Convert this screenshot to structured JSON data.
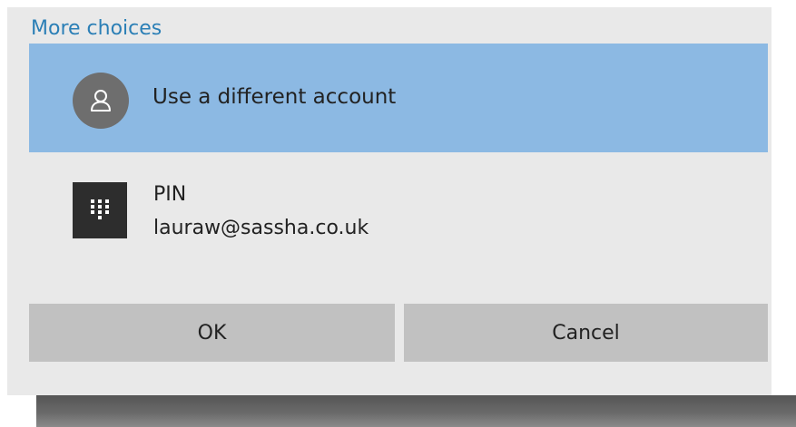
{
  "dialog": {
    "more_choices_label": "More choices",
    "options": [
      {
        "title": "Use a different account",
        "icon": "person-icon",
        "selected": true
      },
      {
        "title": "PIN",
        "subtitle": "lauraw@sassha.co.uk",
        "icon": "keypad-icon",
        "selected": false
      }
    ],
    "ok_label": "OK",
    "cancel_label": "Cancel"
  },
  "colors": {
    "accent_link": "#2b7fb6",
    "selected_row": "#8cb9e3",
    "dialog_background": "#e9e9e9",
    "button_background": "#c1c1c1"
  }
}
